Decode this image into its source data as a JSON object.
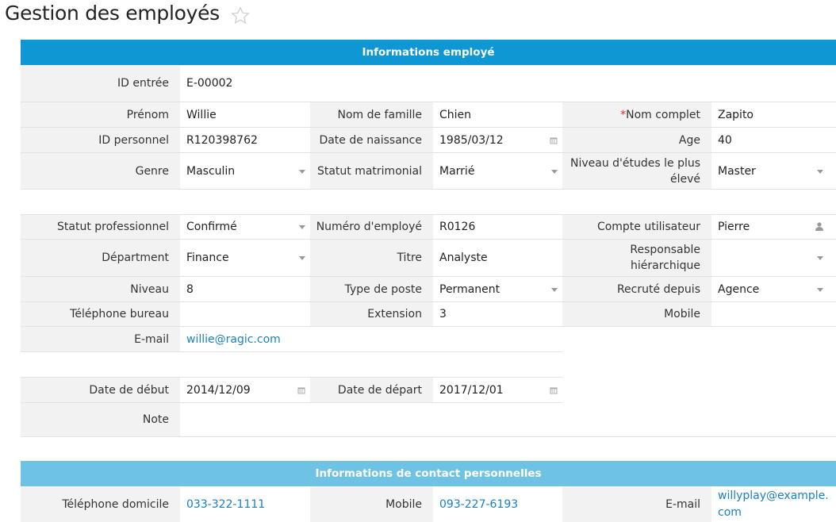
{
  "page": {
    "title": "Gestion des employés"
  },
  "sections": {
    "employee_info": "Informations employé",
    "personal_contact": "Informations de contact personnelles"
  },
  "fields": {
    "entry_id": {
      "label": "ID entrée",
      "value": "E-00002"
    },
    "first_name": {
      "label": "Prénom",
      "value": "Willie"
    },
    "last_name": {
      "label": "Nom de famille",
      "value": "Chien"
    },
    "full_name": {
      "required_mark": "*",
      "label": "Nom complet",
      "value": "Zapito"
    },
    "personal_id": {
      "label": "ID personnel",
      "value": "R120398762"
    },
    "birth_date": {
      "label": "Date de naissance",
      "value": "1985/03/12"
    },
    "age": {
      "label": "Age",
      "value": "40"
    },
    "gender": {
      "label": "Genre",
      "value": "Masculin"
    },
    "marital_status": {
      "label": "Statut matrimonial",
      "value": "Marrié"
    },
    "education": {
      "label": "Niveau d'études le plus élevé",
      "value": "Master"
    },
    "employment_status": {
      "label": "Statut professionnel",
      "value": "Confirmé"
    },
    "employee_number": {
      "label": "Numéro d'employé",
      "value": "R0126"
    },
    "user_account": {
      "label": "Compte utilisateur",
      "value": "Pierre"
    },
    "department": {
      "label": "Départment",
      "value": "Finance"
    },
    "title": {
      "label": "Titre",
      "value": "Analyste"
    },
    "manager": {
      "label": "Responsable hiérarchique",
      "value": ""
    },
    "level": {
      "label": "Niveau",
      "value": "8"
    },
    "position_type": {
      "label": "Type de poste",
      "value": "Permanent"
    },
    "recruited_via": {
      "label": "Recruté depuis",
      "value": "Agence"
    },
    "office_phone": {
      "label": "Téléphone bureau",
      "value": ""
    },
    "extension": {
      "label": "Extension",
      "value": "3"
    },
    "mobile": {
      "label": "Mobile",
      "value": ""
    },
    "email": {
      "label": "E-mail",
      "value": "willie@ragic.com"
    },
    "start_date": {
      "label": "Date de début",
      "value": "2014/12/09"
    },
    "end_date": {
      "label": "Date de départ",
      "value": "2017/12/01"
    },
    "note": {
      "label": "Note",
      "value": ""
    },
    "home_phone": {
      "label": "Téléphone domicile",
      "value": "033-322-1111"
    },
    "personal_mobile": {
      "label": "Mobile",
      "value": "093-227-6193"
    },
    "personal_email": {
      "label": "E-mail",
      "value": "willyplay@example.com"
    }
  },
  "colors": {
    "header_primary": "#0f97d3",
    "header_secondary": "#6ec3e4",
    "label_bg": "#f2f2f2",
    "link": "#1a7fc1",
    "required": "#e03030"
  },
  "icons": {
    "favorite": "star-icon",
    "dropdown": "chevron-down-icon",
    "date": "calendar-icon",
    "user": "user-icon"
  }
}
